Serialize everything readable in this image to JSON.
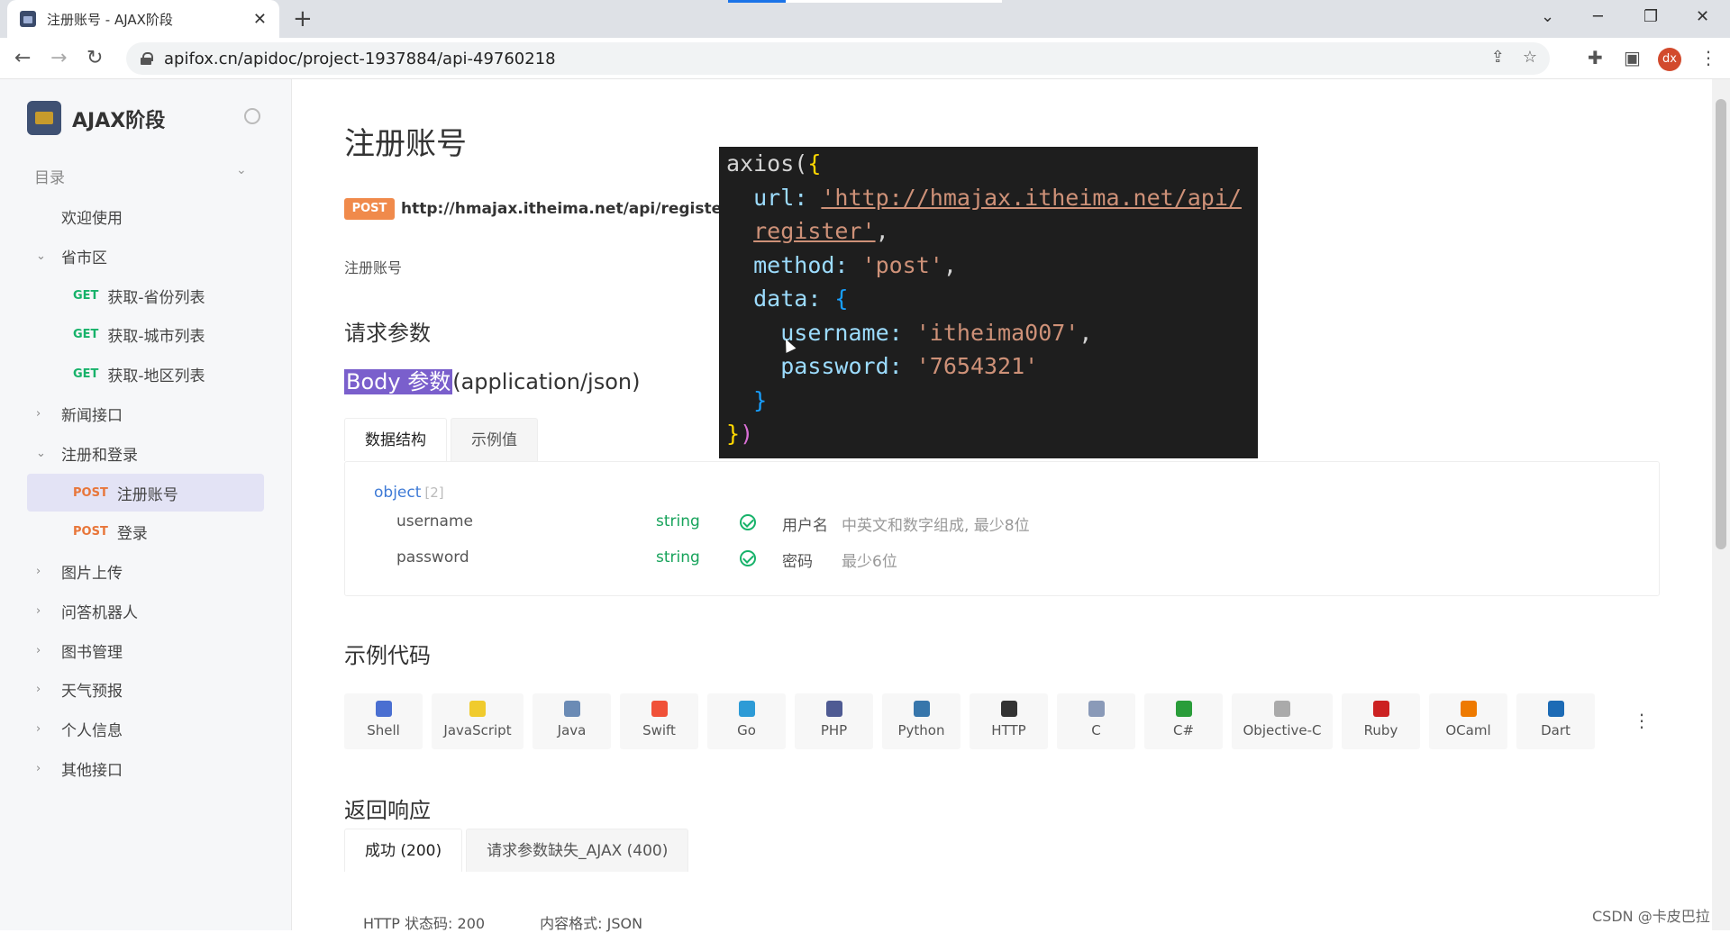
{
  "browser": {
    "tab_title": "注册账号 - AJAX阶段",
    "url": "apifox.cn/apidoc/project-1937884/api-49760218",
    "profile_initials": "dx"
  },
  "sidebar": {
    "project_name": "AJAX阶段",
    "toc_label": "目录",
    "items": [
      {
        "label": "欢迎使用",
        "method": ""
      },
      {
        "label": "省市区",
        "method": ""
      },
      {
        "label": "获取-省份列表",
        "method": "GET"
      },
      {
        "label": "获取-城市列表",
        "method": "GET"
      },
      {
        "label": "获取-地区列表",
        "method": "GET"
      },
      {
        "label": "新闻接口",
        "method": ""
      },
      {
        "label": "注册和登录",
        "method": ""
      },
      {
        "label": "注册账号",
        "method": "POST"
      },
      {
        "label": "登录",
        "method": "POST"
      },
      {
        "label": "图片上传",
        "method": ""
      },
      {
        "label": "问答机器人",
        "method": ""
      },
      {
        "label": "图书管理",
        "method": ""
      },
      {
        "label": "天气预报",
        "method": ""
      },
      {
        "label": "个人信息",
        "method": ""
      },
      {
        "label": "其他接口",
        "method": ""
      }
    ]
  },
  "main": {
    "title": "注册账号",
    "method_badge": "POST",
    "api_url": "http://hmajax.itheima.net/api/register",
    "description": "注册账号",
    "request_params_heading": "请求参数",
    "body_params_highlight": "Body 参数",
    "body_params_type": "(application/json)",
    "schema_tabs": [
      "数据结构",
      "示例值"
    ],
    "schema": {
      "root_type": "object",
      "root_count": "[2]",
      "fields": [
        {
          "name": "username",
          "type": "string",
          "label": "用户名",
          "desc": "中英文和数字组成, 最少8位"
        },
        {
          "name": "password",
          "type": "string",
          "label": "密码",
          "desc": "最少6位"
        }
      ]
    },
    "example_code_heading": "示例代码",
    "languages": [
      "Shell",
      "JavaScript",
      "Java",
      "Swift",
      "Go",
      "PHP",
      "Python",
      "HTTP",
      "C",
      "C#",
      "Objective-C",
      "Ruby",
      "OCaml",
      "Dart"
    ],
    "response_heading": "返回响应",
    "response_tabs": [
      "成功 (200)",
      "请求参数缺失_AJAX (400)"
    ],
    "http_status": "HTTP 状态码: 200",
    "content_type": "内容格式: JSON"
  },
  "code_overlay": {
    "l1": "axios(",
    "l1b": "{",
    "l2_key": "url: ",
    "l2_val": "'http://hmajax.itheima.net/api/",
    "l3_val": "register'",
    "l3_tail": ",",
    "l4_key": "method: ",
    "l4_val": "'post'",
    "l4_tail": ",",
    "l5_key": "data: ",
    "l5_brace": "{",
    "l6_key": "username: ",
    "l6_val": "'itheima007'",
    "l6_tail": ",",
    "l7_key": "password: ",
    "l7_val": "'7654321'",
    "l8": "}",
    "l9a": "}",
    "l9b": ")"
  },
  "watermark": "CSDN @卡皮巴拉",
  "colors": {
    "accent": "#7a5fcc",
    "get": "#17b26a",
    "post": "#e8763a",
    "code_bg": "#1e1e1e"
  }
}
